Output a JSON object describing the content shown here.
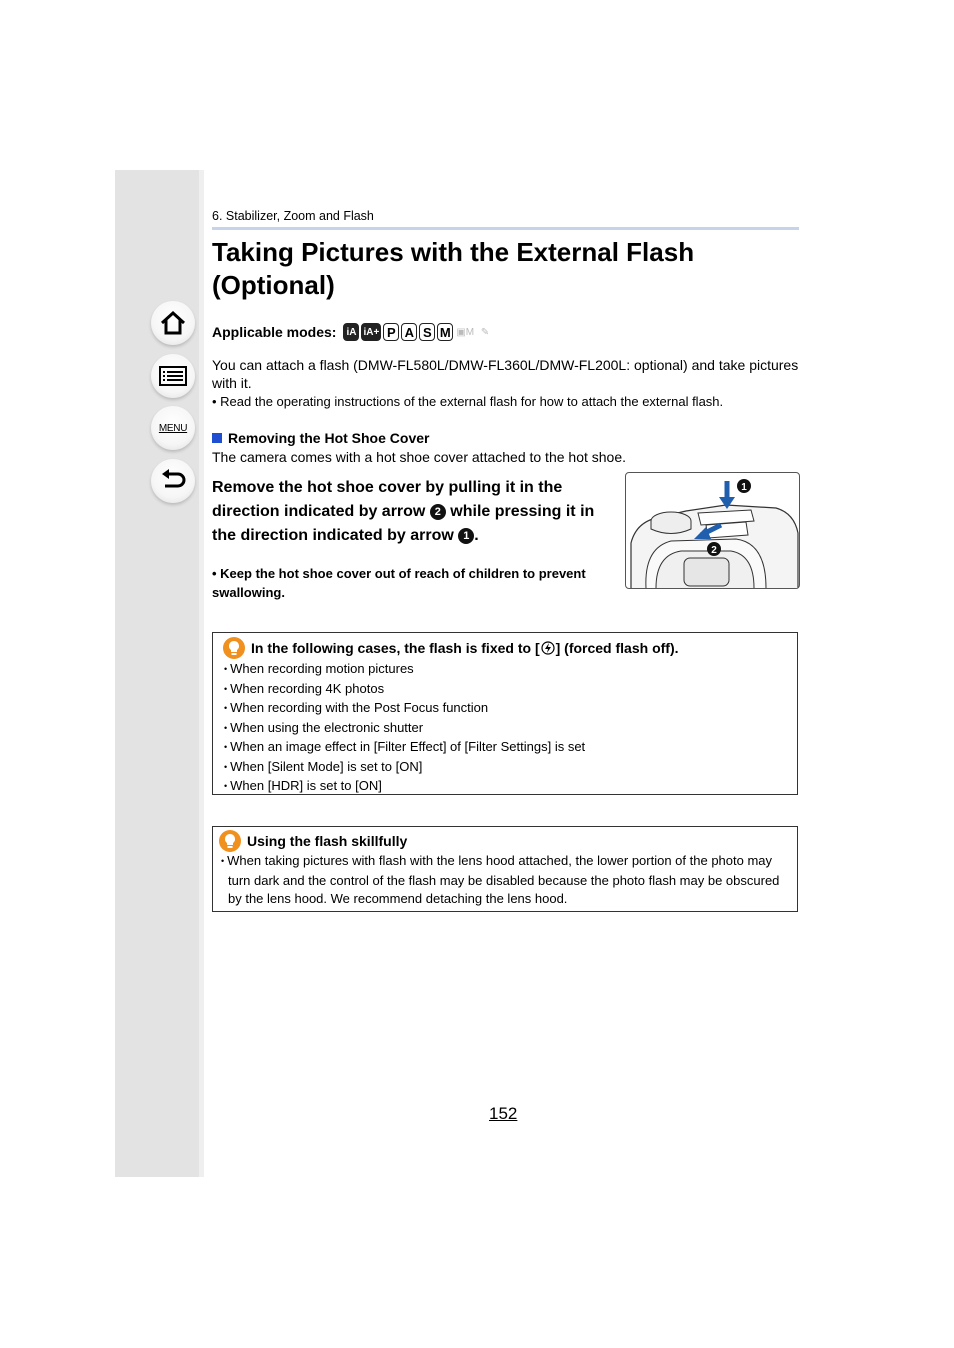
{
  "sidebar": {
    "buttons": [
      {
        "name": "home",
        "icon": "home-icon"
      },
      {
        "name": "contents",
        "icon": "list-icon"
      },
      {
        "name": "menu",
        "icon": "menu-icon",
        "label": "MENU"
      },
      {
        "name": "back",
        "icon": "back-arrow-icon"
      }
    ]
  },
  "header": {
    "breadcrumb": "6. Stabilizer, Zoom and Flash",
    "title": "Taking Pictures with the External Flash (Optional)"
  },
  "modes": {
    "label": "Applicable modes:",
    "items": [
      "iA",
      "iA+",
      "P",
      "A",
      "S",
      "M",
      "Creative Video",
      "Custom"
    ]
  },
  "intro": {
    "text": "You can attach a flash (DMW-FL580L/DMW-FL360L/DMW-FL200L: optional) and take pictures with it.",
    "note": "Read the operating instructions of the external flash for how to attach the external flash."
  },
  "section": {
    "heading": "Removing the Hot Shoe Cover",
    "text": "The camera comes with a hot shoe cover attached to the hot shoe.",
    "step_part1": "Remove the hot shoe cover by pulling it in the direction indicated by arrow ",
    "step_marker2": "2",
    "step_part2": " while pressing it in the direction indicated by arrow ",
    "step_marker1": "1",
    "step_part3": ".",
    "warning": "Keep the hot shoe cover out of reach of children to prevent swallowing.",
    "illustration_markers": [
      "1",
      "2"
    ]
  },
  "box1": {
    "heading": "In the following cases, the flash is fixed to [",
    "heading_icon": "forced-flash-off-icon",
    "heading_end": "] (forced flash off).",
    "items": [
      "When recording motion pictures",
      "When recording 4K photos",
      "When recording with the Post Focus function",
      "When using the electronic shutter",
      "When an image effect in [Filter Effect] of [Filter Settings] is set",
      "When [Silent Mode] is set to [ON]",
      "When [HDR] is set to [ON]"
    ]
  },
  "box2": {
    "heading": "Using the flash skillfully",
    "items": [
      "When taking pictures with flash with the lens hood attached, the lower portion of the photo may turn dark and the control of the flash may be disabled because the photo flash may be obscured by the lens hood. We recommend detaching the lens hood."
    ]
  },
  "footer": {
    "page_number": "152"
  },
  "colors": {
    "sidebar_bg": "#e3e3e3",
    "rule": "#c6d4ea",
    "section_square": "#1f4fd0",
    "tip_icon": "#f0901e"
  }
}
